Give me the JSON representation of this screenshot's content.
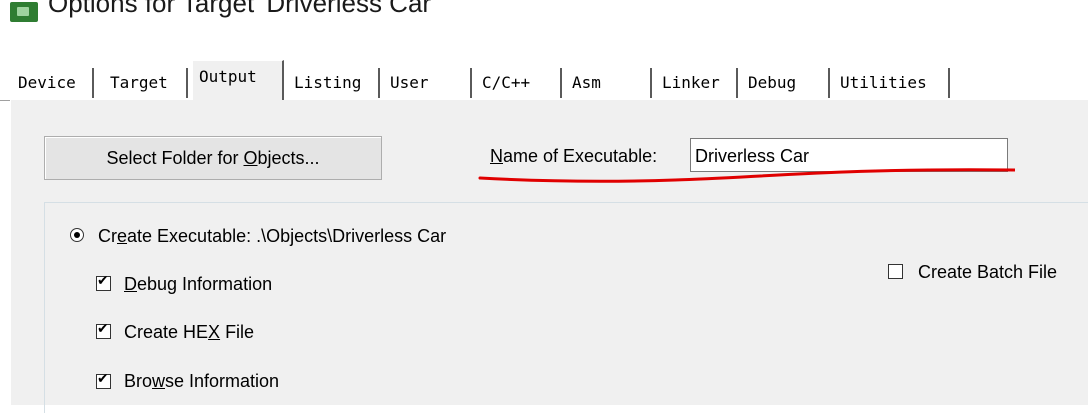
{
  "window": {
    "title": "Options for Target 'Driverless Car'",
    "icon": "app-icon"
  },
  "tabs": [
    {
      "label": "Device",
      "active": false
    },
    {
      "label": "Target",
      "active": false
    },
    {
      "label": "Output",
      "active": true
    },
    {
      "label": "Listing",
      "active": false
    },
    {
      "label": "User",
      "active": false
    },
    {
      "label": "C/C++",
      "active": false
    },
    {
      "label": "Asm",
      "active": false
    },
    {
      "label": "Linker",
      "active": false
    },
    {
      "label": "Debug",
      "active": false
    },
    {
      "label": "Utilities",
      "active": false
    }
  ],
  "output": {
    "select_folder_button": {
      "pre": "Select Folder for ",
      "accel": "O",
      "post": "bjects..."
    },
    "name_label": {
      "accel": "N",
      "rest": "ame of Executable:"
    },
    "name_value": "Driverless Car",
    "create_executable": {
      "pre": "Cr",
      "accel": "e",
      "post": "ate Executable:  .\\Objects\\Driverless Car",
      "selected": true
    },
    "debug_information": {
      "accel": "D",
      "rest": "ebug Information",
      "checked": true
    },
    "create_hex": {
      "pre": "Create HE",
      "accel": "X",
      "post": " File",
      "checked": true
    },
    "browse_information": {
      "pre": "Bro",
      "accel": "w",
      "post": "se Information",
      "checked": true
    },
    "create_batch_file": {
      "label": "Create Batch File",
      "checked": false
    }
  },
  "annotation_color": "#e00000"
}
